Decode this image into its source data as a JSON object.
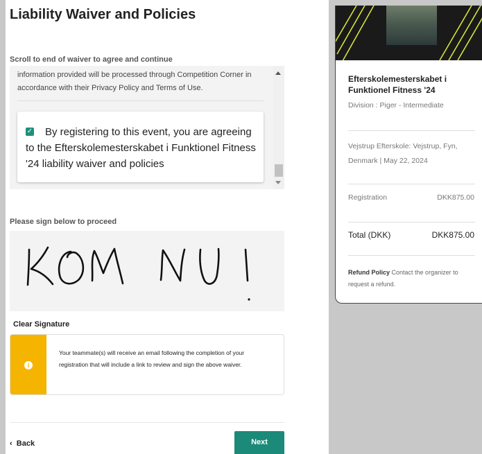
{
  "page": {
    "title": "Liability Waiver and Policies",
    "scroll_hint": "Scroll to end of waiver to agree and continue"
  },
  "waiver": {
    "text": "information provided will be processed through Competition Corner in accordance with their Privacy Policy and Terms of Use.",
    "agree_checked": true,
    "agree_text": "By registering to this event, you are agreeing to the Efterskolemesterskabet i Funktionel Fitness '24 liability waiver and policies"
  },
  "signature": {
    "label": "Please sign below to proceed",
    "handwriting": "KOM NU!",
    "clear_label": "Clear Signature"
  },
  "info_alert": {
    "icon": "info-icon",
    "text": "Your teammate(s) will receive an email following the completion of your registration that will include a link to review and sign the above waiver."
  },
  "footer": {
    "back_label": "Back",
    "next_label": "Next"
  },
  "summary": {
    "event_name": "Efterskolemesterskabet i Funktionel Fitness '24",
    "division": "Division : Piger - Intermediate",
    "location": "Vejstrup Efterskole: Vejstrup, Fyn, Denmark | May 22, 2024",
    "registration_label": "Registration",
    "registration_amount": "DKK875.00",
    "total_label": "Total (DKK)",
    "total_amount": "DKK875.00",
    "refund_title": "Refund Policy",
    "refund_text": "Contact the organizer to request a refund."
  },
  "colors": {
    "accent": "#1b8a78",
    "warning": "#f5b400",
    "background": "#c8c8c8"
  }
}
